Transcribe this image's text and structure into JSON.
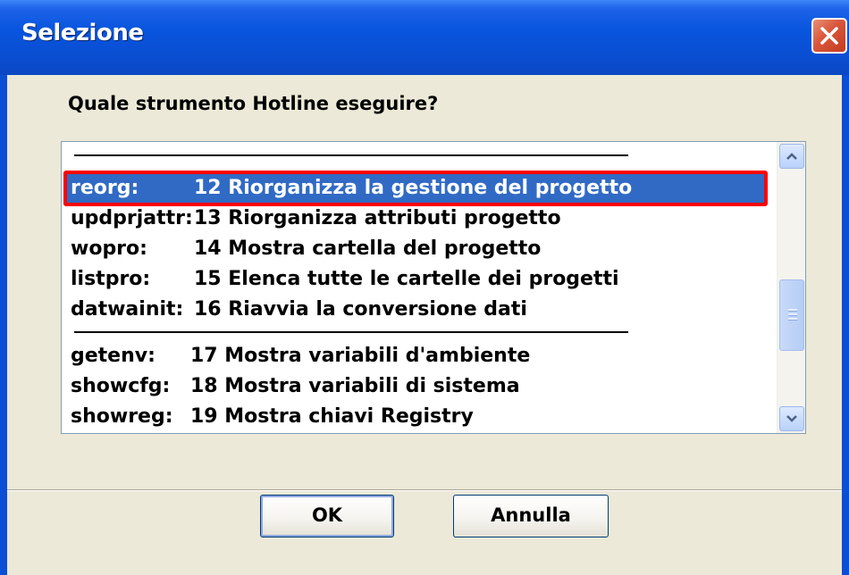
{
  "dialog": {
    "title": "Selezione",
    "prompt": "Quale strumento Hotline eseguire?",
    "close_icon": "close-icon"
  },
  "list": {
    "items": [
      {
        "cmd": "reorg:",
        "desc": "12 Riorganizza la gestione del progetto",
        "selected": true
      },
      {
        "cmd": "updprjattr:",
        "desc": "13 Riorganizza attributi progetto"
      },
      {
        "cmd": "wopro:",
        "desc": "14 Mostra cartella del progetto"
      },
      {
        "cmd": "listpro:",
        "desc": "15 Elenca tutte le cartelle dei progetti"
      },
      {
        "cmd": "datwainit:",
        "desc": "16 Riavvia la conversione dati"
      },
      {
        "cmd": "getenv:",
        "desc": "17 Mostra variabili d'ambiente"
      },
      {
        "cmd": "showcfg:",
        "desc": "18 Mostra variabili di sistema"
      },
      {
        "cmd": "showreg:",
        "desc": "19 Mostra chiavi Registry"
      }
    ]
  },
  "buttons": {
    "ok_label": "OK",
    "cancel_label": "Annulla"
  },
  "colors": {
    "selection": "#316ac5",
    "highlight_outline": "#ff0000",
    "titlebar": "#0a4fd4"
  }
}
